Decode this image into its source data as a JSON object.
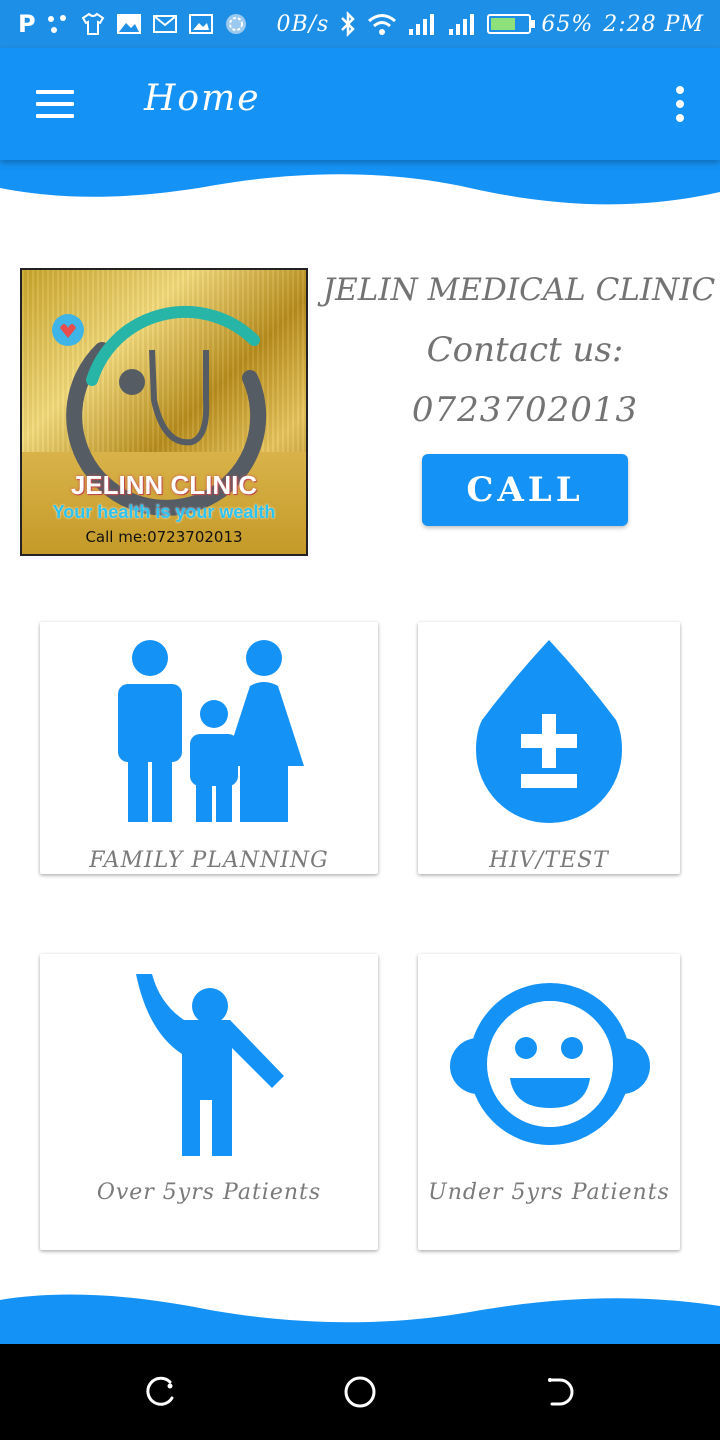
{
  "status_bar": {
    "left_icons": [
      "p-icon",
      "dots-icon",
      "shirt-icon",
      "image-icon",
      "mail-icon",
      "gallery-icon",
      "sync-icon"
    ],
    "speed": "0B/s",
    "battery_percent": "65%",
    "battery_level": 0.65,
    "time": "2:28 PM"
  },
  "app_bar": {
    "title": "Home",
    "color": "#1592f5"
  },
  "logo": {
    "name": "JELINN CLINIC",
    "tagline": "Your health is your wealth",
    "call_text": "Call me:0723702013"
  },
  "clinic": {
    "name": "JELIN MEDICAL CLINIC",
    "contact_label": "Contact us:",
    "phone": "0723702013",
    "call_button": "CALL"
  },
  "cards": [
    {
      "label": "FAMILY PLANNING",
      "icon": "family-icon"
    },
    {
      "label": "HIV/TEST",
      "icon": "blood-drop-plus-minus-icon"
    },
    {
      "label": "Over 5yrs Patients",
      "icon": "person-waving-icon"
    },
    {
      "label": "Under 5yrs Patients",
      "icon": "child-face-icon"
    }
  ],
  "nav_bar": {
    "buttons": [
      "recent-apps-icon",
      "home-icon",
      "back-icon"
    ]
  },
  "colors": {
    "accent": "#1592f5",
    "status_bar": "#1e8fe6",
    "text_gray": "#737373"
  }
}
